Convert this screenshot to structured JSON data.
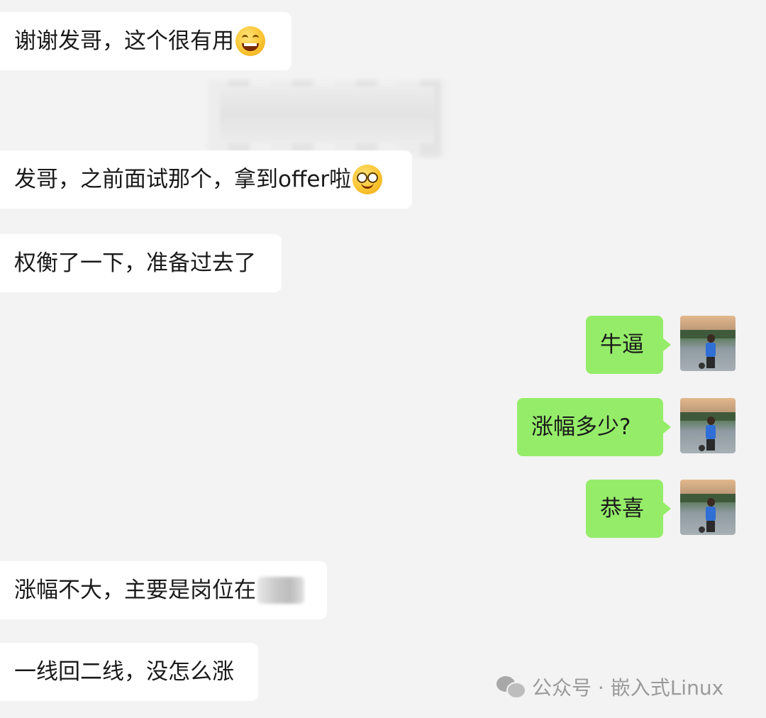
{
  "messages": [
    {
      "side": "in",
      "text": "谢谢发哥，这个很有用",
      "emoji": "grinning-emoji"
    },
    {
      "side": "in",
      "text": "发哥，之前面试那个，拿到offer啦",
      "emoji": "sly-smile-emoji"
    },
    {
      "side": "in",
      "text": "权衡了一下，准备过去了"
    },
    {
      "side": "out",
      "text": "牛逼"
    },
    {
      "side": "out",
      "text": "涨幅多少?"
    },
    {
      "side": "out",
      "text": "恭喜"
    },
    {
      "side": "in",
      "text": "涨幅不大，主要是岗位在",
      "redacted": true
    },
    {
      "side": "in",
      "text": "一线回二线，没怎么涨"
    }
  ],
  "colors": {
    "background": "#f3f3f3",
    "incoming_bubble": "#ffffff",
    "outgoing_bubble": "#95ec69",
    "text": "#1a1a1a",
    "watermark": "#9a9a9a"
  },
  "watermark": {
    "icon": "wechat-icon",
    "text": "公众号 · 嵌入式Linux"
  }
}
